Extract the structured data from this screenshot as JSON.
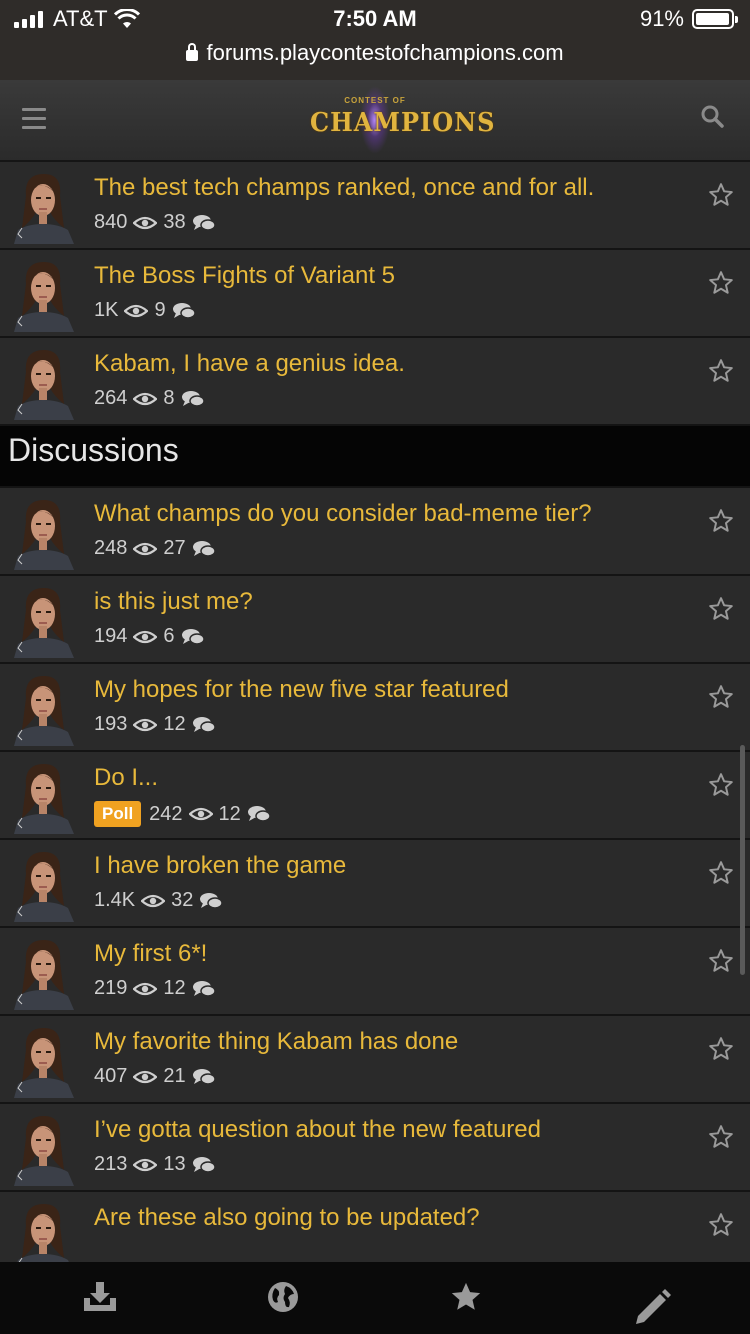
{
  "status": {
    "carrier": "AT&T",
    "time": "7:50 AM",
    "battery": "91%",
    "url": "forums.playcontestofchampions.com"
  },
  "header": {
    "logo_top": "CONTEST OF",
    "logo_main": "CHAMPIONS"
  },
  "top_items": [
    {
      "title": "The best tech champs ranked, once and for all.",
      "views": "840",
      "comments": "38"
    },
    {
      "title": "The Boss Fights of Variant 5",
      "views": "1K",
      "comments": "9"
    },
    {
      "title": "Kabam, I have a genius idea.",
      "views": "264",
      "comments": "8"
    }
  ],
  "section_title": "Discussions",
  "discussions": [
    {
      "title": "What champs do you consider bad-meme tier?",
      "views": "248",
      "comments": "27"
    },
    {
      "title": "is this just me?",
      "views": "194",
      "comments": "6"
    },
    {
      "title": "My hopes for the new five star featured",
      "views": "193",
      "comments": "12"
    },
    {
      "title": "Do I...",
      "badge": "Poll",
      "views": "242",
      "comments": "12"
    },
    {
      "title": "I have broken the game",
      "views": "1.4K",
      "comments": "32"
    },
    {
      "title": "My first 6*!",
      "views": "219",
      "comments": "12"
    },
    {
      "title": "My favorite thing Kabam has done",
      "views": "407",
      "comments": "21"
    },
    {
      "title": "I’ve gotta question about the new featured",
      "views": "213",
      "comments": "13"
    },
    {
      "title": "Are these also going to be updated?",
      "views": "",
      "comments": ""
    }
  ],
  "colors": {
    "title": "#e8b93b",
    "background": "#2a2a2a",
    "poll_badge": "#f0a221"
  },
  "icons": {
    "menu": "hamburger-icon",
    "search": "search-icon",
    "views": "eye-icon",
    "comments": "comment-icon",
    "bookmark": "star-outline-icon",
    "bottom": [
      "download-icon",
      "globe-icon",
      "star-icon",
      "pencil-icon"
    ]
  }
}
